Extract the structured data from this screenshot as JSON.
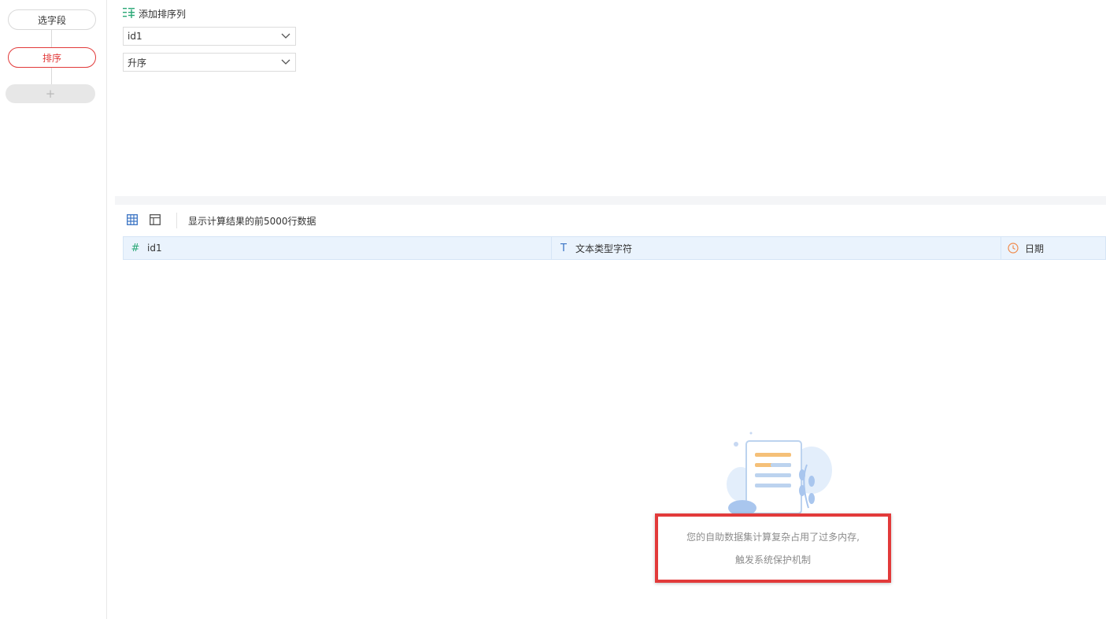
{
  "steps": {
    "select_fields": "选字段",
    "sort": "排序",
    "add": "+"
  },
  "config": {
    "add_sort_column": "添加排序列",
    "sort_field": "id1",
    "sort_order": "升序"
  },
  "preview": {
    "note": "显示计算结果的前5000行数据",
    "columns": [
      {
        "type_icon": "#",
        "label": "id1"
      },
      {
        "type_icon": "T",
        "label": "文本类型字符"
      },
      {
        "type_icon": "clock-icon",
        "label": "日期"
      }
    ]
  },
  "empty_state": {
    "line1": "您的自助数据集计算复杂占用了过多内存,",
    "line2": "触发系统保护机制"
  },
  "colors": {
    "accent_red": "#e23a3a",
    "header_bg": "#eaf3fd",
    "number_icon": "#2aa876",
    "text_icon": "#3b74c4",
    "date_icon": "#f08a4b"
  }
}
